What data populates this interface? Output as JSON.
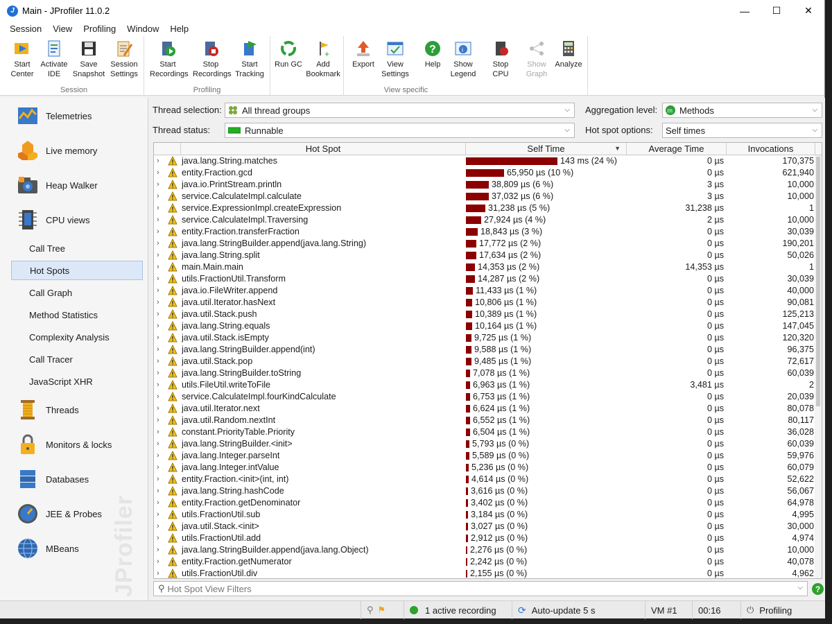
{
  "window": {
    "title": "Main - JProfiler 11.0.2",
    "app_icon_letter": "J",
    "minimize": "—",
    "maximize": "☐",
    "close": "✕"
  },
  "menu": [
    {
      "label": "Session"
    },
    {
      "label": "View"
    },
    {
      "label": "Profiling"
    },
    {
      "label": "Window"
    },
    {
      "label": "Help"
    }
  ],
  "toolbar": {
    "groups": {
      "session": "Session",
      "profiling": "Profiling",
      "view_specific": "View specific"
    },
    "start_center": [
      "Start",
      "Center"
    ],
    "activate_ide": [
      "Activate",
      "IDE"
    ],
    "save_snapshot": [
      "Save",
      "Snapshot"
    ],
    "session_settings": [
      "Session",
      "Settings"
    ],
    "start_recordings": [
      "Start",
      "Recordings"
    ],
    "stop_recordings": [
      "Stop",
      "Recordings"
    ],
    "start_tracking": [
      "Start",
      "Tracking"
    ],
    "run_gc": [
      "Run GC",
      ""
    ],
    "add_bookmark": [
      "Add",
      "Bookmark"
    ],
    "export": [
      "Export",
      ""
    ],
    "view_settings": [
      "View",
      "Settings"
    ],
    "help": [
      "Help",
      ""
    ],
    "show_legend": [
      "Show",
      "Legend"
    ],
    "stop_cpu": [
      "Stop",
      "CPU"
    ],
    "show_graph": [
      "Show",
      "Graph"
    ],
    "analyze": [
      "Analyze",
      ""
    ]
  },
  "sidebar": {
    "telemetries": "Telemetries",
    "live_memory": "Live memory",
    "heap_walker": "Heap Walker",
    "cpu_views": "CPU views",
    "sub": [
      "Call Tree",
      "Hot Spots",
      "Call Graph",
      "Method Statistics",
      "Complexity Analysis",
      "Call Tracer",
      "JavaScript XHR"
    ],
    "threads": "Threads",
    "monitors": "Monitors & locks",
    "databases": "Databases",
    "jee": "JEE & Probes",
    "mbeans": "MBeans",
    "watermark": "JProfiler"
  },
  "filters": {
    "thread_selection_label": "Thread selection:",
    "thread_selection_value": "All thread groups",
    "thread_status_label": "Thread status:",
    "thread_status_value": "Runnable",
    "aggregation_label": "Aggregation level:",
    "aggregation_value": "Methods",
    "hotspot_options_label": "Hot spot options:",
    "hotspot_options_value": "Self times"
  },
  "table": {
    "headers": {
      "hot_spot": "Hot Spot",
      "self_time": "Self Time",
      "avg_time": "Average Time",
      "invocations": "Invocations"
    },
    "bar_color": "#8b0000",
    "rows": [
      {
        "name": "java.lang.String.matches",
        "self": "143 ms (24 %)",
        "pct": 24,
        "avg": "0 µs",
        "inv": "170,375"
      },
      {
        "name": "entity.Fraction.gcd",
        "self": "65,950 µs (10 %)",
        "pct": 10,
        "avg": "0 µs",
        "inv": "621,940"
      },
      {
        "name": "java.io.PrintStream.println",
        "self": "38,809 µs (6 %)",
        "pct": 6,
        "avg": "3 µs",
        "inv": "10,000"
      },
      {
        "name": "service.CalculateImpl.calculate",
        "self": "37,032 µs (6 %)",
        "pct": 6,
        "avg": "3 µs",
        "inv": "10,000"
      },
      {
        "name": "service.ExpressionImpl.createExpression",
        "self": "31,238 µs (5 %)",
        "pct": 5,
        "avg": "31,238 µs",
        "inv": "1"
      },
      {
        "name": "service.CalculateImpl.Traversing",
        "self": "27,924 µs (4 %)",
        "pct": 4,
        "avg": "2 µs",
        "inv": "10,000"
      },
      {
        "name": "entity.Fraction.transferFraction",
        "self": "18,843 µs (3 %)",
        "pct": 3,
        "avg": "0 µs",
        "inv": "30,039"
      },
      {
        "name": "java.lang.StringBuilder.append(java.lang.String)",
        "self": "17,772 µs (2 %)",
        "pct": 2.8,
        "avg": "0 µs",
        "inv": "190,201"
      },
      {
        "name": "java.lang.String.split",
        "self": "17,634 µs (2 %)",
        "pct": 2.8,
        "avg": "0 µs",
        "inv": "50,026"
      },
      {
        "name": "main.Main.main",
        "self": "14,353 µs (2 %)",
        "pct": 2.3,
        "avg": "14,353 µs",
        "inv": "1"
      },
      {
        "name": "utils.FractionUtil.Transform",
        "self": "14,287 µs (2 %)",
        "pct": 2.3,
        "avg": "0 µs",
        "inv": "30,039"
      },
      {
        "name": "java.io.FileWriter.append",
        "self": "11,433 µs (1 %)",
        "pct": 1.8,
        "avg": "0 µs",
        "inv": "40,000"
      },
      {
        "name": "java.util.Iterator.hasNext",
        "self": "10,806 µs (1 %)",
        "pct": 1.7,
        "avg": "0 µs",
        "inv": "90,081"
      },
      {
        "name": "java.util.Stack.push",
        "self": "10,389 µs (1 %)",
        "pct": 1.7,
        "avg": "0 µs",
        "inv": "125,213"
      },
      {
        "name": "java.lang.String.equals",
        "self": "10,164 µs (1 %)",
        "pct": 1.6,
        "avg": "0 µs",
        "inv": "147,045"
      },
      {
        "name": "java.util.Stack.isEmpty",
        "self": "9,725 µs (1 %)",
        "pct": 1.5,
        "avg": "0 µs",
        "inv": "120,320"
      },
      {
        "name": "java.lang.StringBuilder.append(int)",
        "self": "9,588 µs (1 %)",
        "pct": 1.5,
        "avg": "0 µs",
        "inv": "96,375"
      },
      {
        "name": "java.util.Stack.pop",
        "self": "9,485 µs (1 %)",
        "pct": 1.5,
        "avg": "0 µs",
        "inv": "72,617"
      },
      {
        "name": "java.lang.StringBuilder.toString",
        "self": "7,078 µs (1 %)",
        "pct": 1.1,
        "avg": "0 µs",
        "inv": "60,039"
      },
      {
        "name": "utils.FileUtil.writeToFile",
        "self": "6,963 µs (1 %)",
        "pct": 1.1,
        "avg": "3,481 µs",
        "inv": "2"
      },
      {
        "name": "service.CalculateImpl.fourKindCalculate",
        "self": "6,753 µs (1 %)",
        "pct": 1.1,
        "avg": "0 µs",
        "inv": "20,039"
      },
      {
        "name": "java.util.Iterator.next",
        "self": "6,624 µs (1 %)",
        "pct": 1.0,
        "avg": "0 µs",
        "inv": "80,078"
      },
      {
        "name": "java.util.Random.nextInt",
        "self": "6,552 µs (1 %)",
        "pct": 1.0,
        "avg": "0 µs",
        "inv": "80,117"
      },
      {
        "name": "constant.PriorityTable.Priority",
        "self": "6,504 µs (1 %)",
        "pct": 1.0,
        "avg": "0 µs",
        "inv": "36,028"
      },
      {
        "name": "java.lang.StringBuilder.<init>",
        "self": "5,793 µs (0 %)",
        "pct": 0.9,
        "avg": "0 µs",
        "inv": "60,039"
      },
      {
        "name": "java.lang.Integer.parseInt",
        "self": "5,589 µs (0 %)",
        "pct": 0.9,
        "avg": "0 µs",
        "inv": "59,976"
      },
      {
        "name": "java.lang.Integer.intValue",
        "self": "5,236 µs (0 %)",
        "pct": 0.8,
        "avg": "0 µs",
        "inv": "60,079"
      },
      {
        "name": "entity.Fraction.<init>(int, int)",
        "self": "4,614 µs (0 %)",
        "pct": 0.7,
        "avg": "0 µs",
        "inv": "52,622"
      },
      {
        "name": "java.lang.String.hashCode",
        "self": "3,616 µs (0 %)",
        "pct": 0.6,
        "avg": "0 µs",
        "inv": "56,067"
      },
      {
        "name": "entity.Fraction.getDenominator",
        "self": "3,402 µs (0 %)",
        "pct": 0.5,
        "avg": "0 µs",
        "inv": "64,978"
      },
      {
        "name": "utils.FractionUtil.sub",
        "self": "3,184 µs (0 %)",
        "pct": 0.5,
        "avg": "0 µs",
        "inv": "4,995"
      },
      {
        "name": "java.util.Stack.<init>",
        "self": "3,027 µs (0 %)",
        "pct": 0.5,
        "avg": "0 µs",
        "inv": "30,000"
      },
      {
        "name": "utils.FractionUtil.add",
        "self": "2,912 µs (0 %)",
        "pct": 0.5,
        "avg": "0 µs",
        "inv": "4,974"
      },
      {
        "name": "java.lang.StringBuilder.append(java.lang.Object)",
        "self": "2,276 µs (0 %)",
        "pct": 0.4,
        "avg": "0 µs",
        "inv": "10,000"
      },
      {
        "name": "entity.Fraction.getNumerator",
        "self": "2,242 µs (0 %)",
        "pct": 0.4,
        "avg": "0 µs",
        "inv": "40,078"
      },
      {
        "name": "utils.FractionUtil.div",
        "self": "2,155 µs (0 %)",
        "pct": 0.3,
        "avg": "0 µs",
        "inv": "4,962"
      }
    ]
  },
  "search": {
    "placeholder": "Hot Spot View Filters"
  },
  "status": {
    "recording": "1 active recording",
    "auto_update": "Auto-update 5 s",
    "vm": "VM #1",
    "time": "00:16",
    "mode": "Profiling"
  }
}
